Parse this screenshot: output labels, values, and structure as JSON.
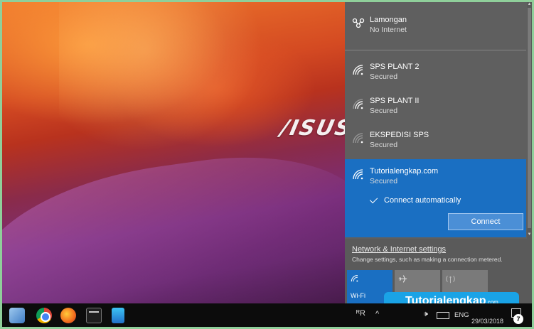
{
  "wallpaper": {
    "brand": "/ISUS"
  },
  "networks": [
    {
      "name": "Lamongan",
      "status": "No Internet",
      "icon": "ethernet-no-internet-icon"
    },
    {
      "name": "SPS PLANT 2",
      "status": "Secured",
      "icon": "wifi-strong-icon"
    },
    {
      "name": "SPS PLANT II",
      "status": "Secured",
      "icon": "wifi-medium-icon"
    },
    {
      "name": "EKSPEDISI SPS",
      "status": "Secured",
      "icon": "wifi-weak-icon"
    },
    {
      "name": "Tutorialengkap.com",
      "status": "Secured",
      "icon": "wifi-strong-icon"
    }
  ],
  "selected_network": {
    "connect_automatically": "Connect automatically",
    "connect_automatically_checked": true,
    "connect_label": "Connect"
  },
  "settings": {
    "link": "Network & Internet settings",
    "description": "Change settings, such as making a connection metered."
  },
  "quick_tiles": [
    {
      "label": "Wi-Fi",
      "icon": "wifi-icon",
      "active": true
    },
    {
      "label": "",
      "icon": "airplane-icon",
      "active": false
    },
    {
      "label": "",
      "icon": "mobile-hotspot-icon",
      "active": false
    }
  ],
  "watermark": {
    "main": "Tutorialengkap",
    "suffix": ".com"
  },
  "taskbar": {
    "apps": [
      "start-icon",
      "chrome-icon",
      "firefox-icon",
      "terminal-icon",
      "installer-icon"
    ],
    "people_glyph": "ᴿR",
    "chevron": "^",
    "speaker": "🕩",
    "language": "ENG",
    "date": "29/03/2018",
    "notification_count": "7"
  },
  "colors": {
    "accent": "#1a6fc2",
    "flyout": "#5f5f5f",
    "taskbar": "#0c0c0c",
    "watermark": "#1aa3e6"
  }
}
